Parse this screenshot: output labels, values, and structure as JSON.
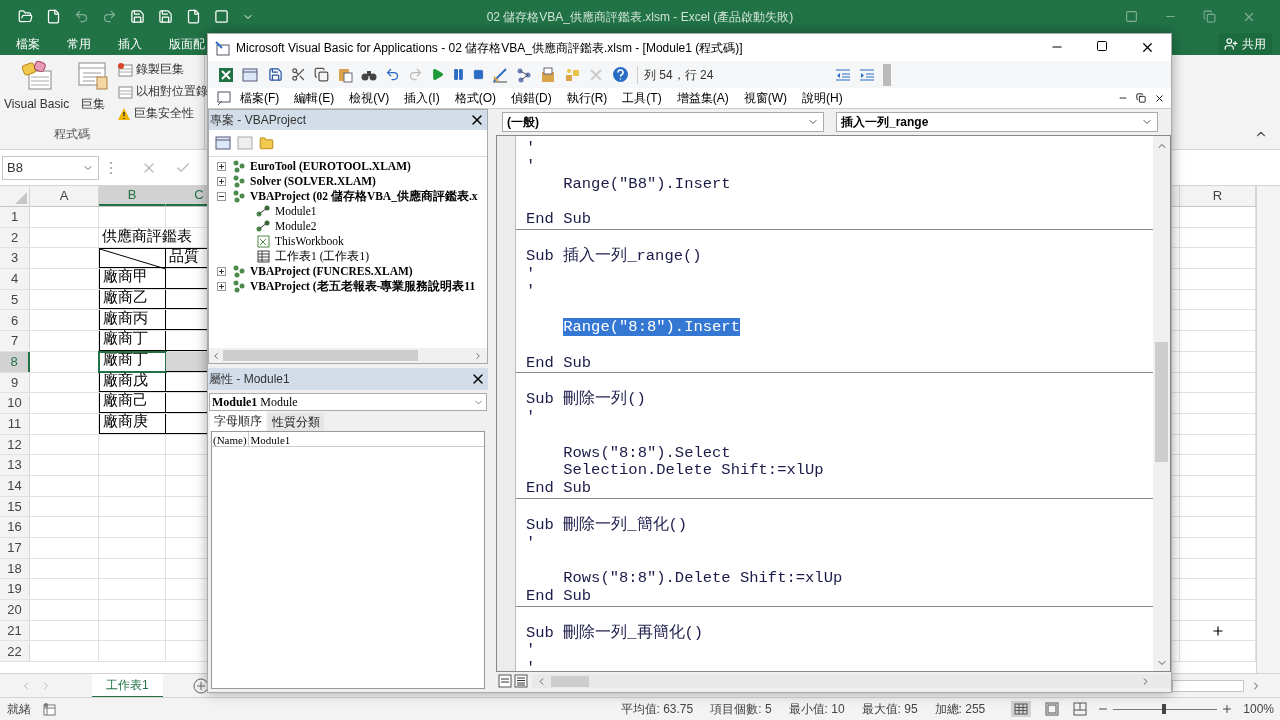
{
  "excel": {
    "title": "02 儲存格VBA_供應商評鑑表.xlsm - Excel (產品啟動失敗)",
    "ribbon_tabs": [
      {
        "label": "檔案"
      },
      {
        "label": "常用"
      },
      {
        "label": "插入"
      },
      {
        "label": "版面配"
      }
    ],
    "share_button": "共用",
    "ribbon_group": {
      "label": "程式碼",
      "large_buttons": [
        "Visual Basic",
        "巨集"
      ],
      "small_buttons": [
        "錄製巨集",
        "以相對位置錄",
        "巨集安全性"
      ]
    },
    "name_box": "B8",
    "columns": [
      {
        "label": "A",
        "selected": false
      },
      {
        "label": "B",
        "selected": true
      },
      {
        "label": "C",
        "selected": true
      },
      {
        "label": "R",
        "selected": false
      }
    ],
    "rows": [
      {
        "label": "1",
        "selected": false
      },
      {
        "label": "2",
        "selected": false
      },
      {
        "label": "3",
        "selected": false
      },
      {
        "label": "4",
        "selected": false
      },
      {
        "label": "5",
        "selected": false
      },
      {
        "label": "6",
        "selected": false
      },
      {
        "label": "7",
        "selected": false
      },
      {
        "label": "8",
        "selected": true
      },
      {
        "label": "9",
        "selected": false
      },
      {
        "label": "10",
        "selected": false
      },
      {
        "label": "11",
        "selected": false
      },
      {
        "label": "12",
        "selected": false
      },
      {
        "label": "13",
        "selected": false
      },
      {
        "label": "14",
        "selected": false
      },
      {
        "label": "15",
        "selected": false
      },
      {
        "label": "16",
        "selected": false
      },
      {
        "label": "17",
        "selected": false
      },
      {
        "label": "18",
        "selected": false
      },
      {
        "label": "19",
        "selected": false
      },
      {
        "label": "20",
        "selected": false
      },
      {
        "label": "21",
        "selected": false
      },
      {
        "label": "22",
        "selected": false
      }
    ],
    "sheet": {
      "title": "供應商評鑑表",
      "header": "品質",
      "vendors": [
        {
          "name": "廠商甲",
          "selected": false
        },
        {
          "name": "廠商乙",
          "selected": false
        },
        {
          "name": "廠商丙",
          "selected": false
        },
        {
          "name": "廠商丁",
          "selected": false
        },
        {
          "name": "廠商丁",
          "selected": true
        },
        {
          "name": "廠商戊",
          "selected": false
        },
        {
          "name": "廠商己",
          "selected": false
        },
        {
          "name": "廠商庚",
          "selected": false
        }
      ]
    },
    "sheet_tabs": [
      {
        "label": "工作表1",
        "selected": true
      }
    ],
    "status": {
      "ready": "就緒",
      "stats": [
        "平均值: 63.75",
        "項目個數: 5",
        "最小值: 10",
        "最大值: 95",
        "加總: 255"
      ],
      "zoom": {
        "label": "100%",
        "level": 0.47
      }
    }
  },
  "vba": {
    "title": "Microsoft Visual Basic for Applications - 02 儲存格VBA_供應商評鑑表.xlsm - [Module1 (程式碼)]",
    "cursor_position": "列 54，行 24",
    "menu": [
      "檔案(F)",
      "編輯(E)",
      "檢視(V)",
      "插入(I)",
      "格式(O)",
      "偵錯(D)",
      "執行(R)",
      "工具(T)",
      "增益集(A)",
      "視窗(W)",
      "說明(H)"
    ],
    "project": {
      "title": "專案 - VBAProject",
      "tree": [
        {
          "label": "EuroTool (EUROTOOL.XLAM)",
          "expanded": false
        },
        {
          "label": "Solver (SOLVER.XLAM)",
          "expanded": false
        },
        {
          "label": "VBAProject (02 儲存格VBA_供應商評鑑表.x",
          "expanded": true,
          "children": [
            {
              "label": "Module1",
              "kind": "module"
            },
            {
              "label": "Module2",
              "kind": "module"
            },
            {
              "label": "ThisWorkbook",
              "kind": "workbook"
            },
            {
              "label": "工作表1 (工作表1)",
              "kind": "sheet"
            }
          ]
        },
        {
          "label": "VBAProject (FUNCRES.XLAM)",
          "expanded": false
        },
        {
          "label": "VBAProject (老五老報表-專業服務說明表11",
          "expanded": false
        }
      ]
    },
    "properties": {
      "title": "屬性 - Module1",
      "object": "**Module1** Module",
      "tabs": [
        {
          "label": "字母順序",
          "selected": true
        },
        {
          "label": "性質分類",
          "selected": false
        }
      ],
      "rows": [
        {
          "name": "(Name)",
          "value": "Module1"
        }
      ]
    },
    "code": {
      "object": "(一般)",
      "procedure": "插入一列_range",
      "blocks": [
        {
          "lines": [
            {
              "kind": "code",
              "text": "'",
              "selected": false
            },
            {
              "kind": "code",
              "text": "'",
              "selected": false
            },
            {
              "kind": "code",
              "text": "    Range(\"B8\").Insert",
              "selected": false
            },
            {
              "kind": "blank"
            },
            {
              "kind": "code",
              "text": "End Sub",
              "selected": false
            }
          ]
        },
        {
          "lines": [
            {
              "kind": "blank"
            },
            {
              "kind": "code",
              "text": "Sub 插入一列_range()",
              "selected": false
            },
            {
              "kind": "code",
              "text": "'",
              "selected": false
            },
            {
              "kind": "code",
              "text": "'",
              "selected": false
            },
            {
              "kind": "blank"
            },
            {
              "kind": "code",
              "text": "    Range(\"8:8\").Insert",
              "selected": true
            },
            {
              "kind": "blank"
            },
            {
              "kind": "code",
              "text": "End Sub",
              "selected": false
            }
          ]
        },
        {
          "lines": [
            {
              "kind": "blank"
            },
            {
              "kind": "code",
              "text": "Sub 刪除一列()",
              "selected": false
            },
            {
              "kind": "code",
              "text": "'",
              "selected": false
            },
            {
              "kind": "blank"
            },
            {
              "kind": "code",
              "text": "    Rows(\"8:8\").Select",
              "selected": false
            },
            {
              "kind": "code",
              "text": "    Selection.Delete Shift:=xlUp",
              "selected": false
            },
            {
              "kind": "code",
              "text": "End Sub",
              "selected": false
            }
          ]
        },
        {
          "lines": [
            {
              "kind": "blank"
            },
            {
              "kind": "code",
              "text": "Sub 刪除一列_簡化()",
              "selected": false
            },
            {
              "kind": "code",
              "text": "'",
              "selected": false
            },
            {
              "kind": "blank"
            },
            {
              "kind": "code",
              "text": "    Rows(\"8:8\").Delete Shift:=xlUp",
              "selected": false
            },
            {
              "kind": "code",
              "text": "End Sub",
              "selected": false
            }
          ]
        },
        {
          "lines": [
            {
              "kind": "blank"
            },
            {
              "kind": "code",
              "text": "Sub 刪除一列_再簡化()",
              "selected": false
            },
            {
              "kind": "code",
              "text": "'",
              "selected": false
            },
            {
              "kind": "code",
              "text": "'",
              "selected": false
            }
          ]
        }
      ]
    }
  }
}
